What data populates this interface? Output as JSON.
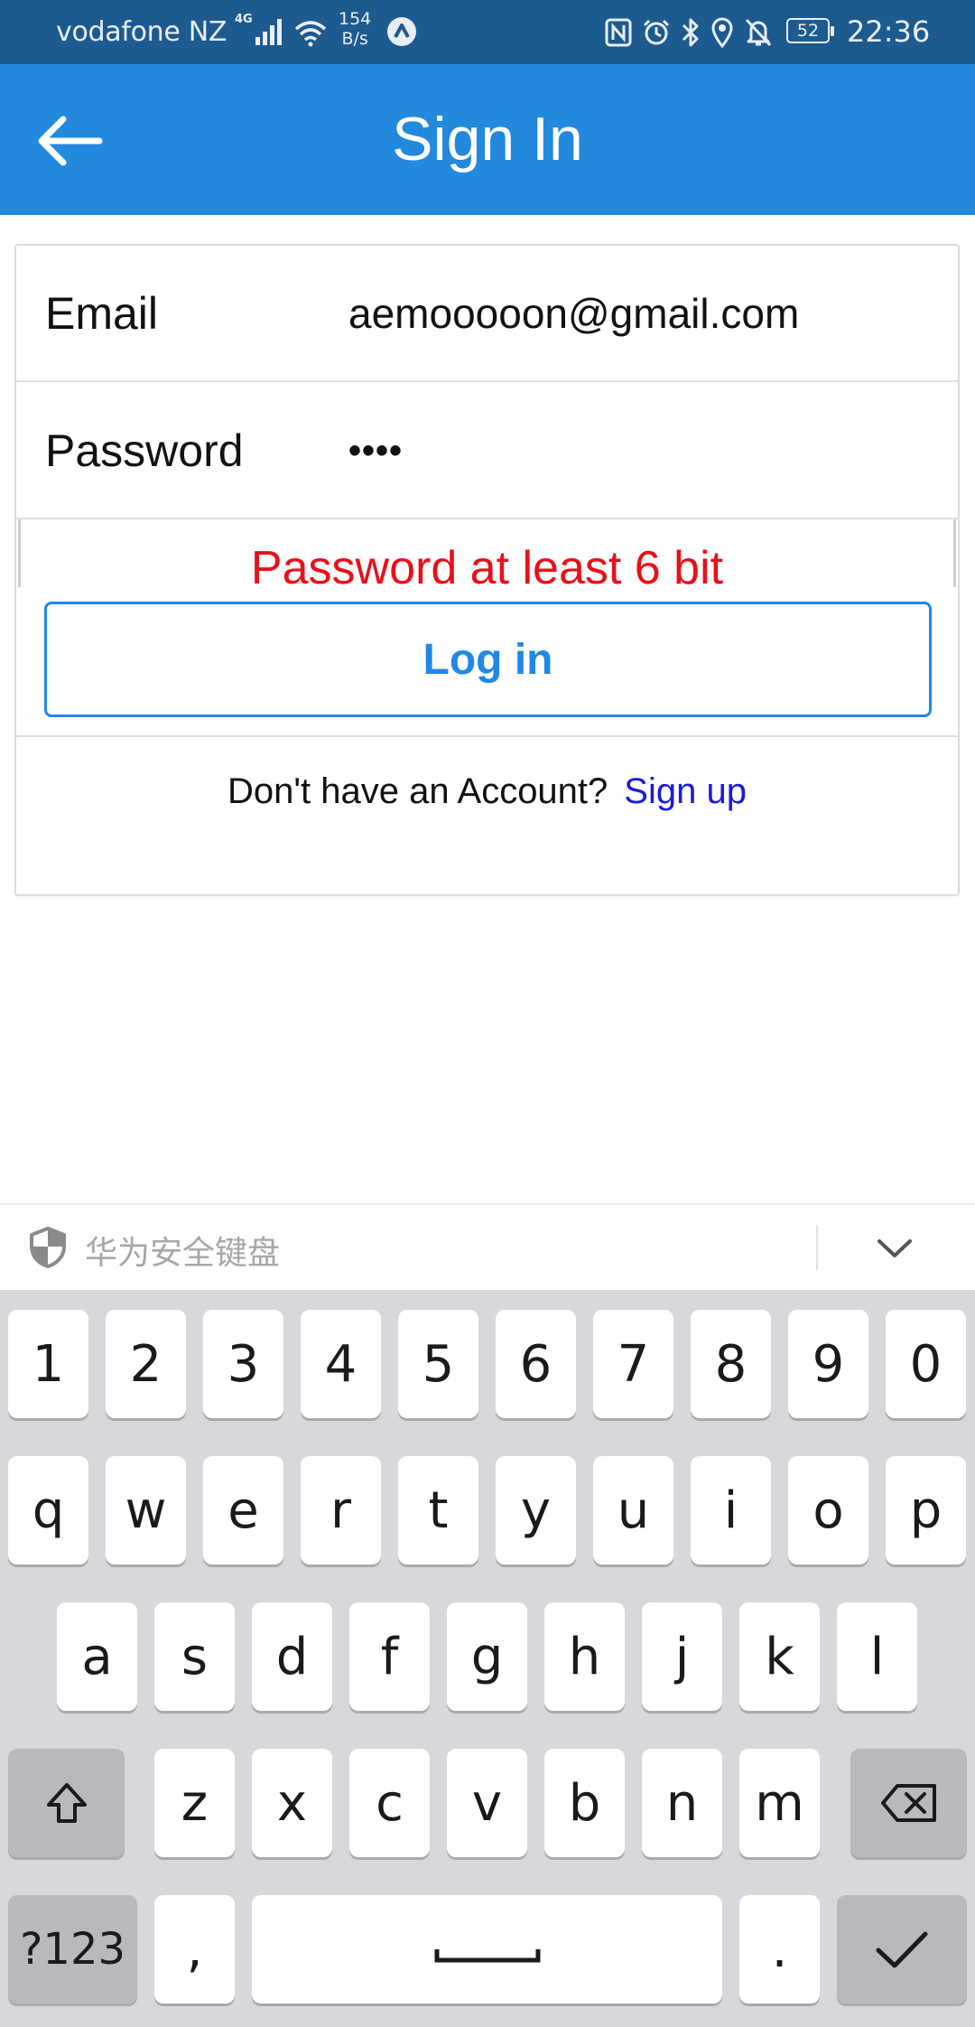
{
  "status_bar": {
    "carrier": "vodafone NZ",
    "network": "4G",
    "speed_value": "154",
    "speed_unit": "B/s",
    "battery": "52",
    "time": "22:36",
    "icons": [
      "nfc-icon",
      "alarm-icon",
      "bluetooth-icon",
      "location-icon",
      "mute-icon"
    ]
  },
  "header": {
    "title": "Sign In",
    "back_icon": "arrow-left-icon",
    "background": "#2289dc"
  },
  "form": {
    "email_label": "Email",
    "email_value": "aemooooon@gmail.com",
    "password_label": "Password",
    "password_value": "••••",
    "error": "Password at least 6 bit",
    "login_button": "Log in",
    "signup_prompt": "Don't have an Account?",
    "signup_link": "Sign up"
  },
  "keyboard": {
    "title": "华为安全键盘",
    "shield_icon": "shield-icon",
    "collapse_icon": "chevron-down-icon",
    "row1": [
      "1",
      "2",
      "3",
      "4",
      "5",
      "6",
      "7",
      "8",
      "9",
      "0"
    ],
    "row2": [
      "q",
      "w",
      "e",
      "r",
      "t",
      "y",
      "u",
      "i",
      "o",
      "p"
    ],
    "row3": [
      "a",
      "s",
      "d",
      "f",
      "g",
      "h",
      "j",
      "k",
      "l"
    ],
    "row4": [
      "z",
      "x",
      "c",
      "v",
      "b",
      "n",
      "m"
    ],
    "symbols_key": "?123",
    "comma_key": ",",
    "period_key": ".",
    "shift_icon": "shift-icon",
    "backspace_icon": "backspace-icon",
    "space_icon": "space-icon",
    "enter_icon": "checkmark-icon"
  },
  "colors": {
    "accent": "#2288e6",
    "error": "#e8101a",
    "link": "#1a1adc",
    "status_bar": "#1c5a8f"
  }
}
